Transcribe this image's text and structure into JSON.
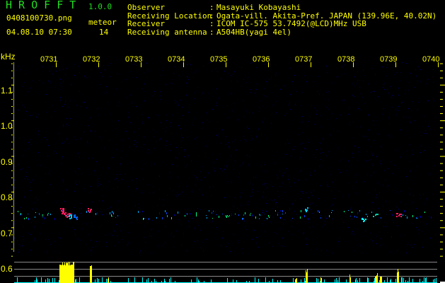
{
  "header": {
    "app_title": "H R O F F T",
    "version": "1.0.0",
    "filename": "0408100730.png",
    "datetime": "04.08.10 07:30",
    "meteor_label": "meteor",
    "meteor_count": "14"
  },
  "info": [
    {
      "label": "Observer",
      "sep": ":",
      "value": "Masayuki Kobayashi"
    },
    {
      "label": "Receiving Location",
      "sep": ":",
      "value": "Ogata-vill. Akita-Pref. JAPAN (139.96E, 40.02N)"
    },
    {
      "label": "Receiver",
      "sep": ":",
      "value": "ICOM IC-575 53.7492(@LCD)MHz USB"
    },
    {
      "label": "Receiving antenna",
      "sep": ":",
      "value": "A504HB(yagi 4el)"
    }
  ],
  "axis": {
    "y_unit": "kHz",
    "y_labels": [
      "1.1",
      "1.0",
      "0.9",
      "0.8",
      "0.7",
      "0.6"
    ],
    "x_labels": [
      "0731",
      "0732",
      "0733",
      "0734",
      "0735",
      "0736",
      "0737",
      "0738",
      "0739",
      "0740"
    ]
  },
  "colors": {
    "text": "#ffff00",
    "title": "#22dd22",
    "level_low": "#00ffff",
    "level_high": "#ffff00",
    "grid": "#888888"
  }
}
